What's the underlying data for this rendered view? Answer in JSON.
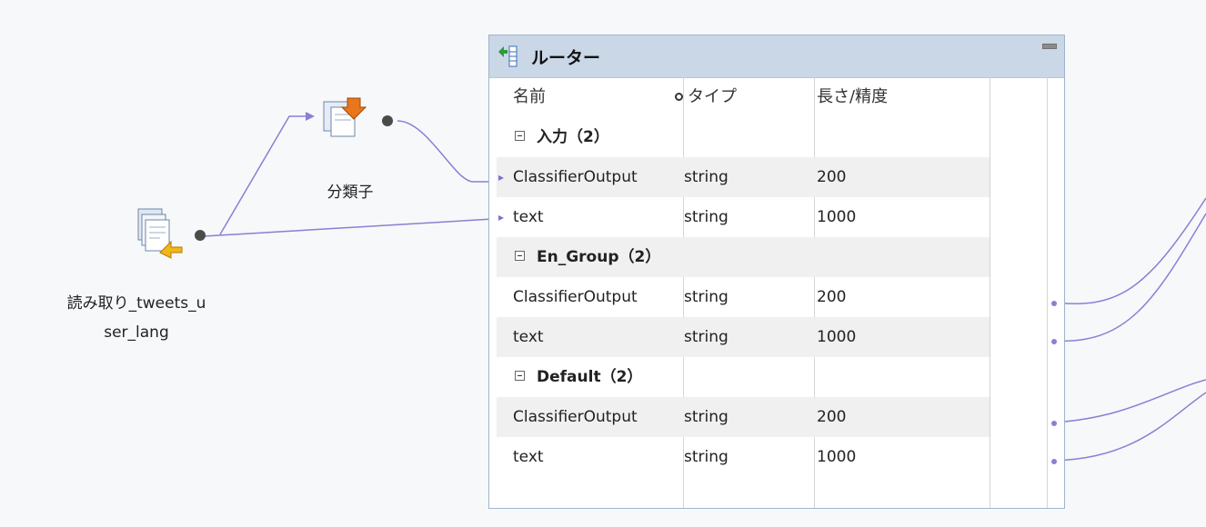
{
  "nodes": {
    "reader": {
      "label_line1": "読み取り_tweets_u",
      "label_line2": "ser_lang",
      "icon": "read-source-icon"
    },
    "classifier": {
      "label": "分類子",
      "icon": "classifier-icon"
    }
  },
  "router": {
    "title": "ルーター",
    "icon": "router-icon",
    "columns": {
      "name": "名前",
      "type": "タイプ",
      "length": "長さ/精度"
    },
    "groups": [
      {
        "label": "入力（2）",
        "rows": [
          {
            "name": "ClassifierOutput",
            "type": "string",
            "length": "200"
          },
          {
            "name": "text",
            "type": "string",
            "length": "1000"
          }
        ]
      },
      {
        "label": "En_Group（2）",
        "rows": [
          {
            "name": "ClassifierOutput",
            "type": "string",
            "length": "200"
          },
          {
            "name": "text",
            "type": "string",
            "length": "1000"
          }
        ]
      },
      {
        "label": "Default（2）",
        "rows": [
          {
            "name": "ClassifierOutput",
            "type": "string",
            "length": "200"
          },
          {
            "name": "text",
            "type": "string",
            "length": "1000"
          }
        ]
      }
    ]
  },
  "colors": {
    "link": "#8a7fd6",
    "panel_header": "#c9d7e6",
    "panel_border": "#9fb5cc"
  }
}
